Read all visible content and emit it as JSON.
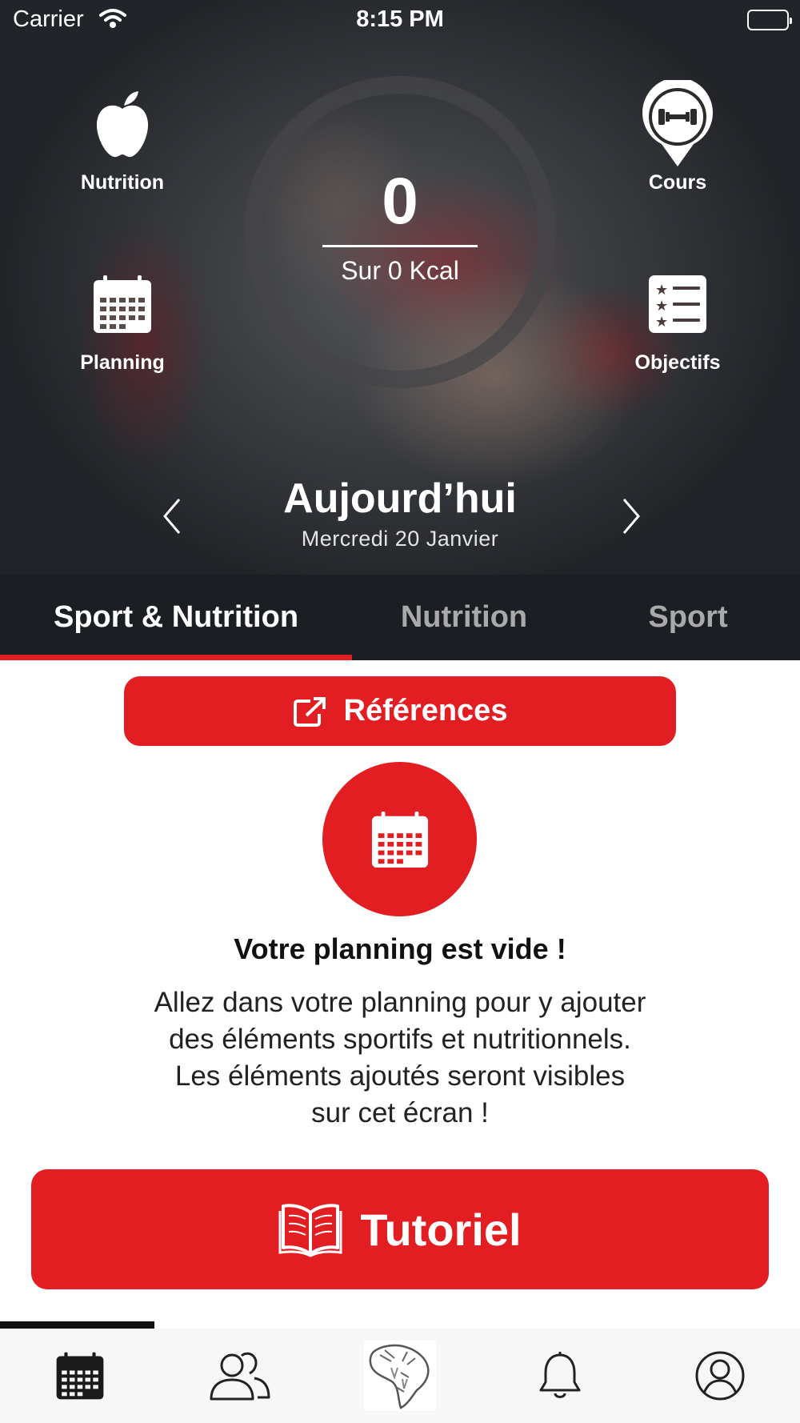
{
  "status_bar": {
    "carrier": "Carrier",
    "time": "8:15 PM"
  },
  "summary": {
    "kcal_consumed": "0",
    "kcal_target_text": "Sur 0 Kcal"
  },
  "shortcuts": {
    "nutrition": {
      "label": "Nutrition",
      "icon": "apple-icon"
    },
    "cours": {
      "label": "Cours",
      "icon": "dumbbell-pin-icon"
    },
    "planning": {
      "label": "Planning",
      "icon": "calendar-icon"
    },
    "objectifs": {
      "label": "Objectifs",
      "icon": "star-list-icon"
    }
  },
  "day_selector": {
    "title": "Aujourd’hui",
    "date": "Mercredi 20 Janvier"
  },
  "tabs": [
    {
      "label": "Sport & Nutrition",
      "active": true
    },
    {
      "label": "Nutrition",
      "active": false
    },
    {
      "label": "Sport",
      "active": false
    }
  ],
  "references_button": {
    "label": "Références",
    "icon": "external-link-icon"
  },
  "empty_state": {
    "icon": "calendar-icon",
    "title": "Votre planning est vide !",
    "lines": [
      "Allez dans votre planning pour y ajouter",
      "des éléments sportifs et nutritionnels.",
      "Les éléments ajoutés seront visibles",
      "sur cet écran !"
    ]
  },
  "tutorial_button": {
    "label": "Tutoriel",
    "icon": "open-book-icon"
  },
  "bottom_nav": [
    {
      "icon": "calendar-icon",
      "active": true
    },
    {
      "icon": "community-icon",
      "active": false
    },
    {
      "icon": "tiger-logo-icon",
      "active": false
    },
    {
      "icon": "bell-icon",
      "active": false
    },
    {
      "icon": "profile-icon",
      "active": false
    }
  ],
  "colors": {
    "accent": "#e21e22",
    "tab_bar": "#1b1e22",
    "nav_bg": "#f7f7f7"
  }
}
